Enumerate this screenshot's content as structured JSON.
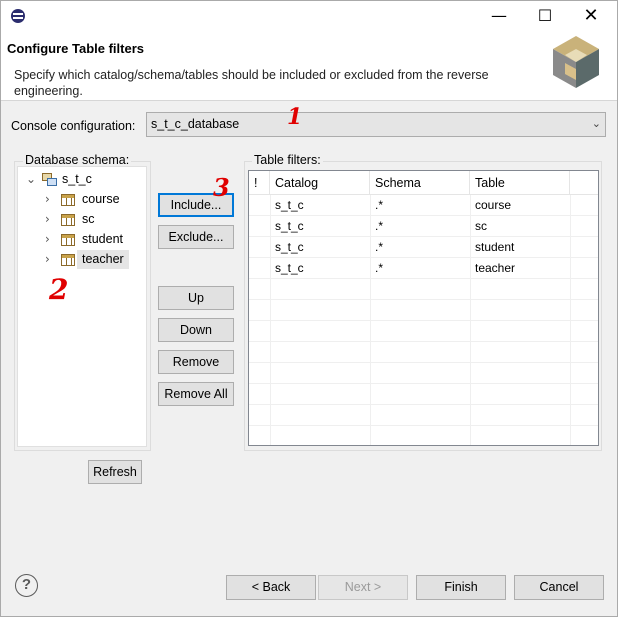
{
  "window": {
    "min_glyph": "—",
    "max_glyph": "☐",
    "close_glyph": "✕"
  },
  "header": {
    "title": "Configure Table filters",
    "description": "Specify which catalog/schema/tables should be included or excluded from the reverse engineering."
  },
  "console": {
    "label": "Console configuration:",
    "value": "s_t_c_database"
  },
  "schema": {
    "legend": "Database schema:",
    "root": "s_t_c",
    "tables": [
      "course",
      "sc",
      "student",
      "teacher"
    ],
    "selected": "teacher"
  },
  "buttons": {
    "include": "Include...",
    "exclude": "Exclude...",
    "up": "Up",
    "down": "Down",
    "remove": "Remove",
    "remove_all": "Remove All",
    "refresh": "Refresh"
  },
  "filters": {
    "legend": "Table filters:",
    "columns": [
      "!",
      "Catalog",
      "Schema",
      "Table"
    ],
    "rows": [
      {
        "catalog": "s_t_c",
        "schema": ".*",
        "table": "course"
      },
      {
        "catalog": "s_t_c",
        "schema": ".*",
        "table": "sc"
      },
      {
        "catalog": "s_t_c",
        "schema": ".*",
        "table": "student"
      },
      {
        "catalog": "s_t_c",
        "schema": ".*",
        "table": "teacher"
      }
    ]
  },
  "footer": {
    "help": "?",
    "back": "< Back",
    "next": "Next >",
    "finish": "Finish",
    "cancel": "Cancel"
  },
  "annotations": {
    "one": "1",
    "two": "2",
    "three": "3"
  },
  "colors": {
    "accent": "#0078d7",
    "annotation": "#e00000"
  }
}
